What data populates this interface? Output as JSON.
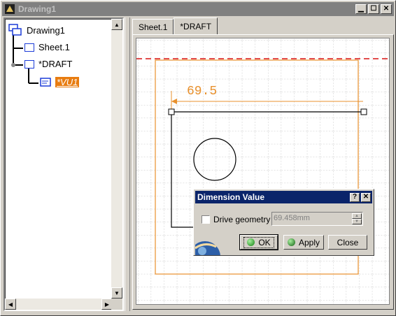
{
  "window": {
    "title": "Drawing1"
  },
  "tree": {
    "items": [
      {
        "label": "Drawing1"
      },
      {
        "label": "Sheet.1"
      },
      {
        "label": "*DRAFT"
      },
      {
        "label": "*VU1"
      }
    ]
  },
  "tabs": [
    {
      "label": "Sheet.1"
    },
    {
      "label": "*DRAFT"
    }
  ],
  "drawing": {
    "dimension_text": "69.5"
  },
  "dialog": {
    "title": "Dimension Value",
    "help_label": "?",
    "close_label": "✕",
    "checkbox_label": "Drive geometry",
    "checkbox_checked": false,
    "value": "69.458mm",
    "ok_label": "OK",
    "apply_label": "Apply",
    "close_button_label": "Close"
  },
  "colors": {
    "selection": "#e87c10",
    "dimension": "#e8902c",
    "dialog_title": "#0a246a",
    "tree_icon": "#1c3cd8"
  }
}
